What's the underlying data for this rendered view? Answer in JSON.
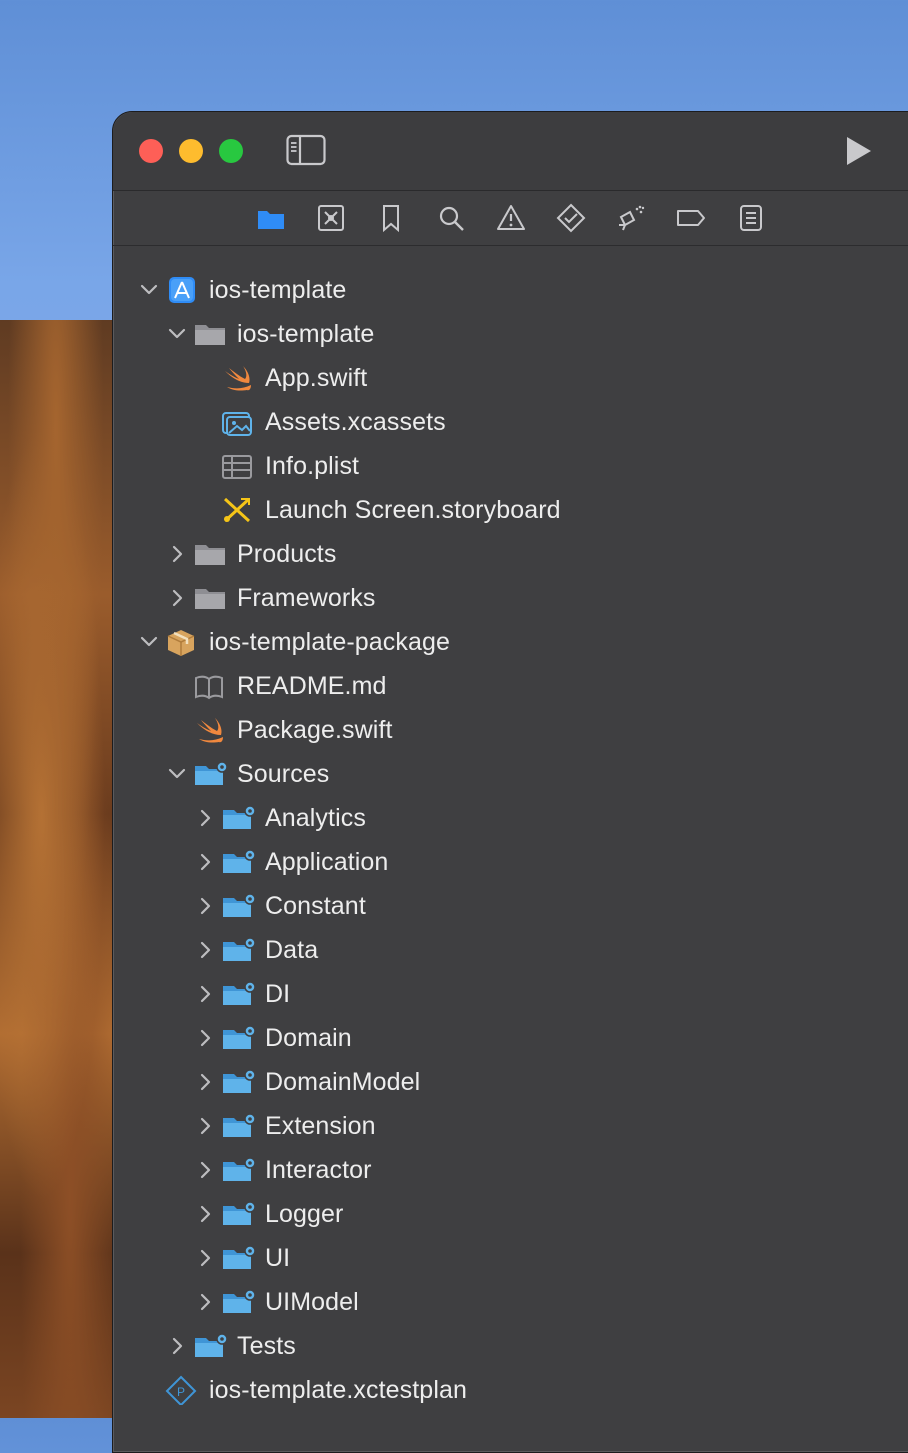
{
  "window": {
    "title_controls": [
      "close",
      "minimize",
      "zoom"
    ]
  },
  "toolbar": {
    "run_icon": "play-icon",
    "sidebar_icon": "sidebar-toggle-icon"
  },
  "navigator_tabs": [
    {
      "icon": "folder-icon",
      "selected": true
    },
    {
      "icon": "source-control-icon"
    },
    {
      "icon": "bookmark-icon"
    },
    {
      "icon": "search-icon"
    },
    {
      "icon": "warning-icon"
    },
    {
      "icon": "test-icon"
    },
    {
      "icon": "debug-icon"
    },
    {
      "icon": "breakpoint-icon"
    },
    {
      "icon": "report-icon"
    }
  ],
  "tree": [
    {
      "label": "ios-template",
      "indent": 0,
      "chevron": "down",
      "icon": "xcode-project-icon"
    },
    {
      "label": "ios-template",
      "indent": 1,
      "chevron": "down",
      "icon": "gray-folder-icon"
    },
    {
      "label": "App.swift",
      "indent": 2,
      "chevron": "none",
      "icon": "swift-file-icon"
    },
    {
      "label": "Assets.xcassets",
      "indent": 2,
      "chevron": "none",
      "icon": "asset-catalog-icon"
    },
    {
      "label": "Info.plist",
      "indent": 2,
      "chevron": "none",
      "icon": "plist-icon"
    },
    {
      "label": "Launch Screen.storyboard",
      "indent": 2,
      "chevron": "none",
      "icon": "storyboard-icon"
    },
    {
      "label": "Products",
      "indent": 1,
      "chevron": "right",
      "icon": "gray-folder-icon"
    },
    {
      "label": "Frameworks",
      "indent": 1,
      "chevron": "right",
      "icon": "gray-folder-icon"
    },
    {
      "label": "ios-template-package",
      "indent": 0,
      "chevron": "down",
      "icon": "package-icon"
    },
    {
      "label": "README.md",
      "indent": 1,
      "chevron": "none",
      "icon": "book-icon"
    },
    {
      "label": "Package.swift",
      "indent": 1,
      "chevron": "none",
      "icon": "swift-file-icon"
    },
    {
      "label": "Sources",
      "indent": 1,
      "chevron": "down",
      "icon": "blue-folder-icon"
    },
    {
      "label": "Analytics",
      "indent": 2,
      "chevron": "right",
      "icon": "blue-folder-icon"
    },
    {
      "label": "Application",
      "indent": 2,
      "chevron": "right",
      "icon": "blue-folder-icon"
    },
    {
      "label": "Constant",
      "indent": 2,
      "chevron": "right",
      "icon": "blue-folder-icon"
    },
    {
      "label": "Data",
      "indent": 2,
      "chevron": "right",
      "icon": "blue-folder-icon"
    },
    {
      "label": "DI",
      "indent": 2,
      "chevron": "right",
      "icon": "blue-folder-icon"
    },
    {
      "label": "Domain",
      "indent": 2,
      "chevron": "right",
      "icon": "blue-folder-icon"
    },
    {
      "label": "DomainModel",
      "indent": 2,
      "chevron": "right",
      "icon": "blue-folder-icon"
    },
    {
      "label": "Extension",
      "indent": 2,
      "chevron": "right",
      "icon": "blue-folder-icon"
    },
    {
      "label": "Interactor",
      "indent": 2,
      "chevron": "right",
      "icon": "blue-folder-icon"
    },
    {
      "label": "Logger",
      "indent": 2,
      "chevron": "right",
      "icon": "blue-folder-icon"
    },
    {
      "label": "UI",
      "indent": 2,
      "chevron": "right",
      "icon": "blue-folder-icon"
    },
    {
      "label": "UIModel",
      "indent": 2,
      "chevron": "right",
      "icon": "blue-folder-icon"
    },
    {
      "label": "Tests",
      "indent": 1,
      "chevron": "right",
      "icon": "blue-folder-icon"
    },
    {
      "label": "ios-template.xctestplan",
      "indent": 0,
      "chevron": "none",
      "icon": "test-plan-icon"
    }
  ],
  "colors": {
    "accent": "#2f8cf6",
    "folder_blue": "#5aaee6",
    "folder_gray": "#9a9a9e",
    "swift": "#f0883e"
  }
}
